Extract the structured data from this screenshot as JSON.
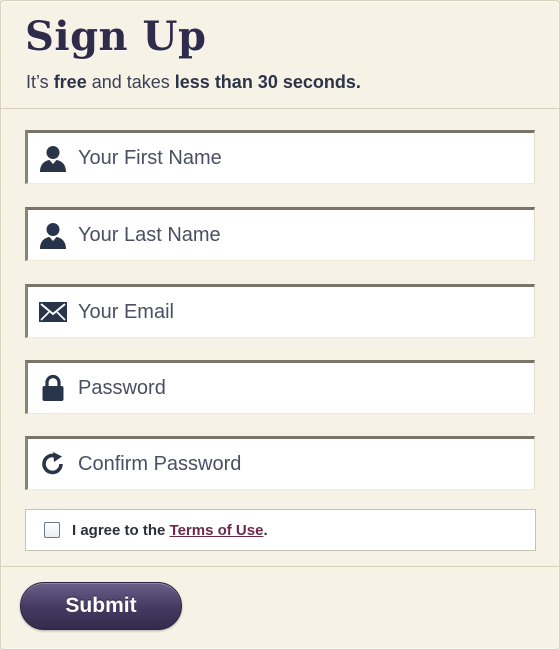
{
  "header": {
    "title": "Sign Up",
    "subtitle": {
      "prefix": "It’s ",
      "free": "free",
      "middle": " and takes ",
      "duration": "less than 30 seconds."
    }
  },
  "fields": [
    {
      "icon": "user-icon",
      "placeholder": "Your First Name",
      "value": ""
    },
    {
      "icon": "user-icon",
      "placeholder": "Your Last Name",
      "value": ""
    },
    {
      "icon": "envelope-icon",
      "placeholder": "Your Email",
      "value": ""
    },
    {
      "icon": "lock-icon",
      "placeholder": "Password",
      "value": ""
    },
    {
      "icon": "refresh-icon",
      "placeholder": "Confirm Password",
      "value": ""
    }
  ],
  "terms": {
    "checked": false,
    "prefix": "I agree to the ",
    "link_label": "Terms of Use",
    "suffix": "."
  },
  "submit_label": "Submit",
  "colors": {
    "panel": "#f7f2e6",
    "heading": "#2f2b4a",
    "icon": "#283449",
    "link": "#6b2a4a",
    "button": "#463c64"
  }
}
